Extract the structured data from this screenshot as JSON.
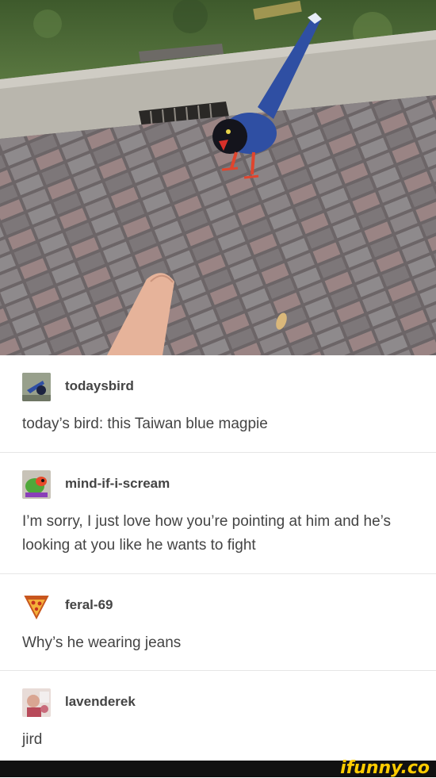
{
  "posts": [
    {
      "username": "todaysbird",
      "text": "today’s bird: this Taiwan blue magpie",
      "avatar": "bird-avatar-icon"
    },
    {
      "username": "mind-if-i-scream",
      "text": "I’m sorry, I just love how you’re pointing at him and he’s looking at you like he wants to fight",
      "avatar": "parrot-avatar-icon"
    },
    {
      "username": "feral-69",
      "text": "Why’s he wearing jeans",
      "avatar": "pizza-avatar-icon"
    },
    {
      "username": "lavenderek",
      "text": "jird",
      "avatar": "person-avatar-icon"
    }
  ],
  "watermark": {
    "text": "ifunny.co",
    "color": "#ffcc00"
  },
  "colors": {
    "magpie_blue": "#2f4fa3",
    "paving": "#7a7474",
    "grass": "#4c6b34"
  }
}
